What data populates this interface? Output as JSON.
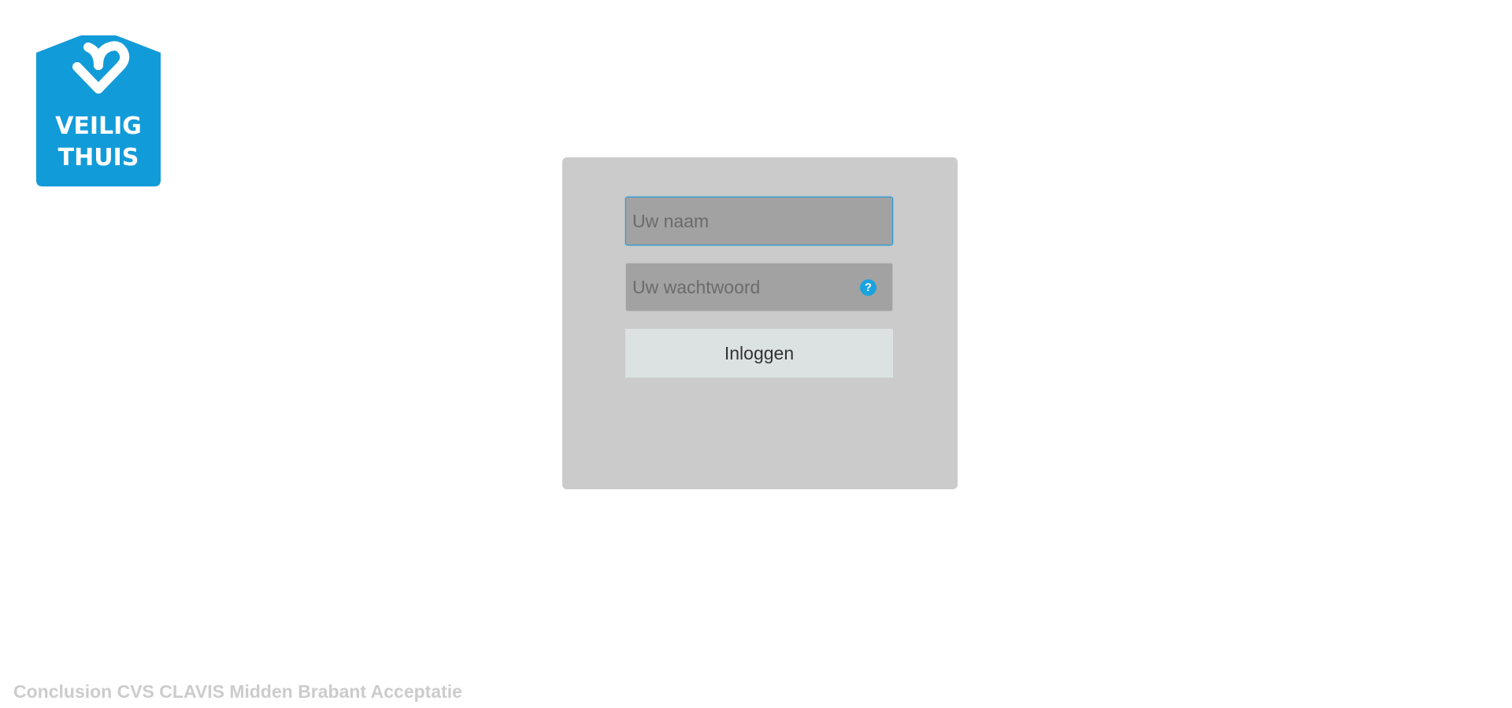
{
  "logo": {
    "line1": "VEILIG",
    "line2": "THUIS",
    "color": "#129bd9"
  },
  "login": {
    "username_placeholder": "Uw naam",
    "username_value": "",
    "password_placeholder": "Uw wachtwoord",
    "password_value": "",
    "help_icon": "question-circle-icon",
    "help_glyph": "?",
    "login_button_label": "Inloggen",
    "focus_color": "#1e9ad6"
  },
  "footer": {
    "text": "Conclusion CVS CLAVIS Midden Brabant Acceptatie"
  }
}
